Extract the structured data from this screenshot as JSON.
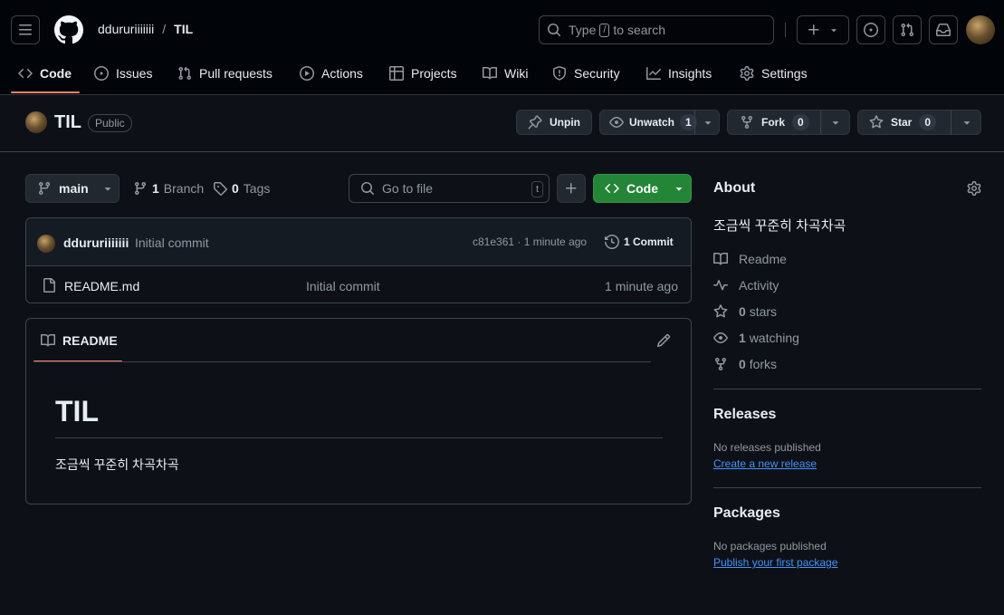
{
  "header": {
    "owner": "ddururiiiiiii",
    "separator": "/",
    "repo": "TIL",
    "search_prefix": "Type",
    "search_key": "/",
    "search_suffix": "to search"
  },
  "tabs": [
    {
      "label": "Code",
      "icon": "code-icon"
    },
    {
      "label": "Issues",
      "icon": "issue-opened-icon"
    },
    {
      "label": "Pull requests",
      "icon": "git-pull-request-icon"
    },
    {
      "label": "Actions",
      "icon": "play-icon"
    },
    {
      "label": "Projects",
      "icon": "table-icon"
    },
    {
      "label": "Wiki",
      "icon": "book-icon"
    },
    {
      "label": "Security",
      "icon": "shield-icon"
    },
    {
      "label": "Insights",
      "icon": "graph-icon"
    },
    {
      "label": "Settings",
      "icon": "gear-icon"
    }
  ],
  "repo_header": {
    "name": "TIL",
    "visibility": "Public",
    "unpin": "Unpin",
    "unwatch": "Unwatch",
    "watch_count": "1",
    "fork": "Fork",
    "fork_count": "0",
    "star": "Star",
    "star_count": "0"
  },
  "filebar": {
    "branch": "main",
    "branch_count": "1",
    "branch_label": "Branch",
    "tag_count": "0",
    "tag_label": "Tags",
    "go_to_file": "Go to file",
    "go_key": "t",
    "code_button": "Code"
  },
  "commit": {
    "author": "ddururiiiiiii",
    "message": "Initial commit",
    "hash_time": "c81e361 · 1 minute ago",
    "commits": "1 Commit"
  },
  "files": [
    {
      "name": "README.md",
      "message": "Initial commit",
      "time": "1 minute ago"
    }
  ],
  "readme": {
    "tab": "README",
    "title": "TIL",
    "body": "조금씩 꾸준히 차곡차곡"
  },
  "about": {
    "heading": "About",
    "description": "조금씩 꾸준히 차곡차곡",
    "readme": "Readme",
    "activity": "Activity",
    "stars_count": "0",
    "stars_label": "stars",
    "watching_count": "1",
    "watching_label": "watching",
    "forks_count": "0",
    "forks_label": "forks"
  },
  "releases": {
    "heading": "Releases",
    "empty": "No releases published",
    "link": "Create a new release"
  },
  "packages": {
    "heading": "Packages",
    "empty": "No packages published",
    "link": "Publish your first package"
  },
  "colors": {
    "background": "#0d1117",
    "header_bg": "#010409",
    "border": "#3d444d",
    "accent_tab": "#f78166",
    "code_button": "#238636",
    "link": "#4493f8",
    "muted": "#9198a1"
  }
}
